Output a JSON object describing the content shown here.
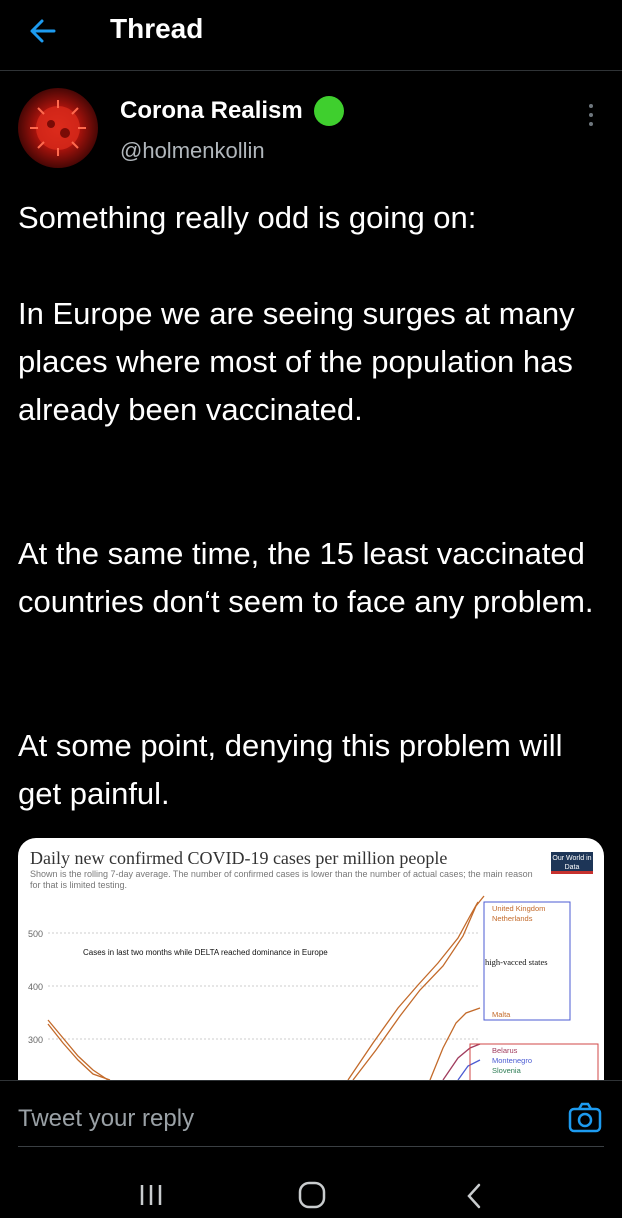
{
  "header": {
    "title": "Thread"
  },
  "tweet": {
    "author_name": "Corona Realism",
    "author_handle": "@holmenkollin",
    "paragraphs": [
      "Something really odd is going on:",
      "In Europe we are seeing surges at many places where most of the population has already been vaccinated.",
      "At the same time, the 15 least vaccinated countries don‘t seem to face any problem.",
      "At some point, denying this problem will get painful."
    ]
  },
  "media": {
    "logo_text": "Our World in Data",
    "chart_data": {
      "type": "line",
      "title": "Daily new confirmed COVID-19 cases per million people",
      "subtitle": "Shown is the rolling 7-day average. The number of confirmed cases is lower than the number of actual cases; the main reason for that is limited testing.",
      "annotation": "Cases in last two months while DELTA reached dominance in Europe",
      "y_ticks": [
        "500",
        "400",
        "300"
      ],
      "ylim": [
        250,
        560
      ],
      "legend_groups": [
        {
          "label": "high-vacced states",
          "color": "#4b5bd3"
        },
        {
          "label": "",
          "color": "#d24747"
        }
      ],
      "series": [
        {
          "name": "United Kingdom",
          "color": "#c36a2a"
        },
        {
          "name": "Netherlands",
          "color": "#c36a2a"
        },
        {
          "name": "Malta",
          "color": "#c36a2a"
        },
        {
          "name": "Belarus",
          "color": "#a13c5e"
        },
        {
          "name": "Montenegro",
          "color": "#4b5bd3"
        },
        {
          "name": "Slovenia",
          "color": "#2e7d55"
        }
      ]
    }
  },
  "reply": {
    "placeholder": "Tweet your reply"
  },
  "colors": {
    "accent": "#1d9bf0",
    "background": "#000000",
    "verified": "#3fcf2e"
  },
  "icons": [
    "back-arrow-icon",
    "verified-icon",
    "more-vertical-icon",
    "camera-icon",
    "nav-recents-icon",
    "nav-home-icon",
    "nav-back-icon"
  ]
}
